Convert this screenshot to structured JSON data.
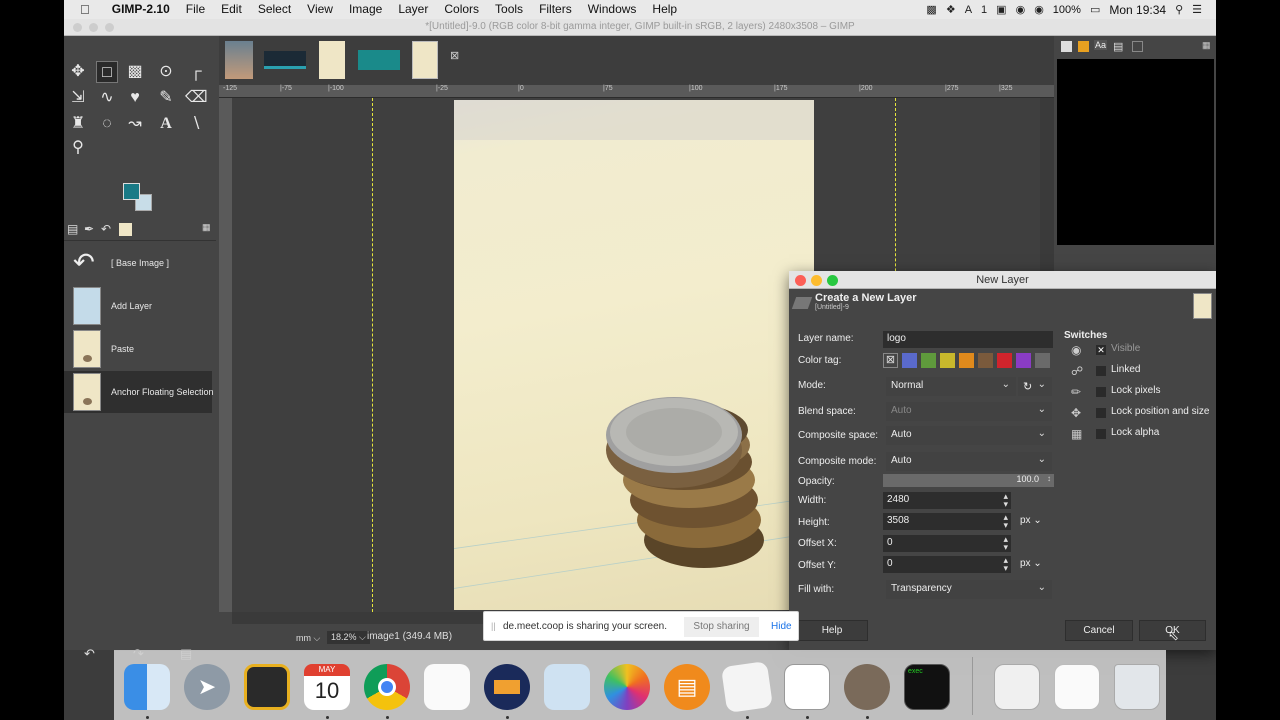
{
  "menubar": {
    "apple": "",
    "app_name": "GIMP-2.10",
    "items": [
      "File",
      "Edit",
      "Select",
      "View",
      "Image",
      "Layer",
      "Colors",
      "Tools",
      "Filters",
      "Windows",
      "Help"
    ],
    "battery": "100%",
    "clock": "Mon 19:34",
    "status_icons": [
      "monitor-icon",
      "dropbox-icon",
      "adobe-icon",
      "one-icon",
      "screen-icon",
      "location-icon",
      "wifi-icon",
      "battery-icon",
      "search-icon",
      "list-icon"
    ]
  },
  "gimp": {
    "window_title": "*[Untitled]-9.0 (RGB color 8-bit gamma integer, GIMP built-in sRGB, 2 layers) 2480x3508 – GIMP",
    "undo_history": [
      {
        "label": "[ Base Image ]",
        "thumb": "undo-icon"
      },
      {
        "label": "Add Layer",
        "thumb": "blue-thumb"
      },
      {
        "label": "Paste",
        "thumb": "coin-thumb"
      },
      {
        "label": "Anchor Floating Selection",
        "thumb": "coin-thumb"
      }
    ],
    "ruler_labels": [
      "-125",
      "|-100",
      "|-75",
      "|-50",
      "|-25",
      "|0",
      "|25",
      "|50",
      "|75",
      "|100",
      "|125",
      "|150",
      "|175",
      "|200",
      "|225",
      "|250",
      "|275",
      "|300",
      "|325"
    ],
    "status": {
      "unit": "mm",
      "zoom": "18.2%",
      "info": "image1 (349.4 MB)"
    },
    "fg_color": "#1a7a86",
    "bg_color": "#c8dde8"
  },
  "dialog": {
    "title": "New Layer",
    "header_title": "Create a New Layer",
    "header_sub": "[Untitled]-9",
    "layer_name_label": "Layer name:",
    "layer_name_value": "logo",
    "color_tag_label": "Color tag:",
    "color_tags": [
      "#5a6acc",
      "#5f9a3c",
      "#c8b82c",
      "#e08a1c",
      "#7a5a3c",
      "#d0242c",
      "#8a3cc4",
      "#6a6a6a"
    ],
    "mode_label": "Mode:",
    "mode_value": "Normal",
    "blend_space_label": "Blend space:",
    "blend_space_value": "Auto",
    "composite_space_label": "Composite space:",
    "composite_space_value": "Auto",
    "composite_mode_label": "Composite mode:",
    "composite_mode_value": "Auto",
    "opacity_label": "Opacity:",
    "opacity_value": "100.0",
    "width_label": "Width:",
    "width_value": "2480",
    "height_label": "Height:",
    "height_value": "3508",
    "size_unit": "px",
    "offset_x_label": "Offset X:",
    "offset_x_value": "0",
    "offset_y_label": "Offset Y:",
    "offset_y_value": "0",
    "offset_unit": "px",
    "fill_label": "Fill with:",
    "fill_value": "Transparency",
    "switches_title": "Switches",
    "switches": [
      {
        "label": "Visible",
        "icon": "eye-icon",
        "checked": true
      },
      {
        "label": "Linked",
        "icon": "chain-icon",
        "checked": false
      },
      {
        "label": "Lock pixels",
        "icon": "brush-icon",
        "checked": false
      },
      {
        "label": "Lock position and size",
        "icon": "move-icon",
        "checked": false
      },
      {
        "label": "Lock alpha",
        "icon": "checker-icon",
        "checked": false
      }
    ],
    "help_button": "Help",
    "cancel_button": "Cancel",
    "ok_button": "OK"
  },
  "share_banner": {
    "message": "de.meet.coop is sharing your screen.",
    "stop_button": "Stop sharing",
    "hide_button": "Hide"
  },
  "dock": {
    "calendar_month": "MAY",
    "calendar_day": "10",
    "apps": [
      "finder",
      "launchpad",
      "photo-booth",
      "calendar",
      "chrome",
      "reminders",
      "audacity",
      "preview",
      "photos",
      "books",
      "textedit",
      "notes-blank",
      "gimp",
      "terminal",
      "documents",
      "stack",
      "trash"
    ]
  }
}
